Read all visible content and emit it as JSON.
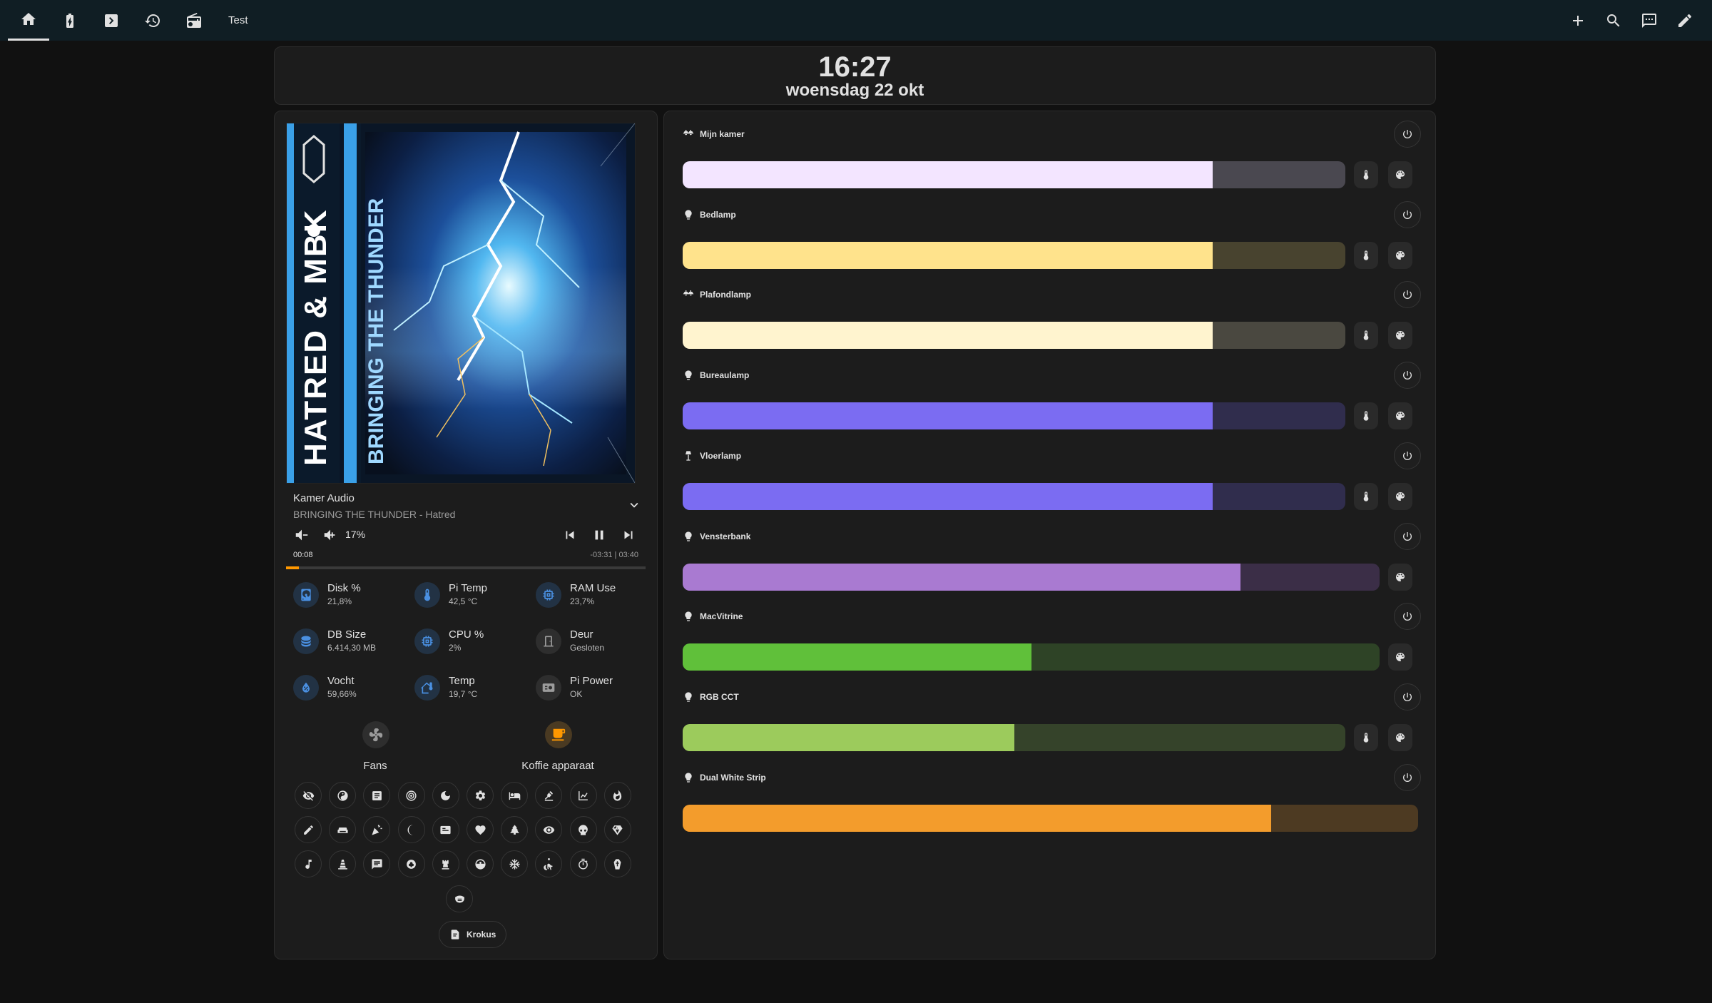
{
  "header": {
    "tabs": [
      {
        "icon": "home-icon"
      },
      {
        "icon": "battery-charging-icon"
      },
      {
        "icon": "chevron-right-box-icon"
      },
      {
        "icon": "history-icon"
      },
      {
        "icon": "radio-icon"
      }
    ],
    "text_tab": "Test",
    "tools": [
      {
        "icon": "plus-icon"
      },
      {
        "icon": "search-icon"
      },
      {
        "icon": "assist-chat-icon"
      },
      {
        "icon": "pencil-icon"
      }
    ]
  },
  "clock": {
    "time": "16:27",
    "date": "woensdag 22 okt"
  },
  "media": {
    "album_art": {
      "artist_text": "HATRED & MBK",
      "title_text": "BRINGING THE THUNDER"
    },
    "player_name": "Kamer Audio",
    "track": "BRINGING THE THUNDER - Hatred",
    "volume": "17%",
    "position": "00:08",
    "remaining": "-03:31 | 03:40",
    "progress_fraction": 0.036
  },
  "sensors": [
    {
      "name": "Disk %",
      "value": "21,8%",
      "icon": "harddisk-icon"
    },
    {
      "name": "Pi Temp",
      "value": "42,5 °C",
      "icon": "thermometer-icon"
    },
    {
      "name": "RAM Use",
      "value": "23,7%",
      "icon": "memory-icon"
    },
    {
      "name": "DB Size",
      "value": "6.414,30 MB",
      "icon": "database-icon"
    },
    {
      "name": "CPU %",
      "value": "2%",
      "icon": "cpu-icon"
    },
    {
      "name": "Deur",
      "value": "Gesloten",
      "icon": "door-closed-icon"
    },
    {
      "name": "Vocht",
      "value": "59,66%",
      "icon": "water-percent-icon"
    },
    {
      "name": "Temp",
      "value": "19,7 °C",
      "icon": "home-thermometer-icon"
    },
    {
      "name": "Pi Power",
      "value": "OK",
      "icon": "power-supply-icon"
    }
  ],
  "toggles": [
    {
      "label": "Fans",
      "icon": "fan-icon",
      "state": "off"
    },
    {
      "label": "Koffie apparaat",
      "icon": "coffee-icon",
      "state": "on"
    }
  ],
  "chips": [
    "eye-off-icon",
    "yin-yang-icon",
    "notes-icon",
    "target-icon",
    "moon-icon",
    "cog-icon",
    "bed-icon",
    "beach-icon",
    "chart-icon",
    "fire-icon",
    "pencil-icon",
    "couch-icon",
    "party-popper-icon",
    "moon-crescent-icon",
    "card-icon",
    "heart-icon",
    "pine-tree-icon",
    "eye-icon",
    "skull-icon",
    "diamond-icon",
    "music-icon",
    "cone-icon",
    "message-icon",
    "flower-icon",
    "chess-rook-icon",
    "robot-vacuum-icon",
    "snowflake-icon",
    "wheelchair-icon",
    "timer-icon",
    "coffin-icon",
    "face-mask-icon"
  ],
  "krokus_chip": {
    "label": "Krokus",
    "icon": "script-icon"
  },
  "lights": [
    {
      "name": "Mijn kamer",
      "icon": "ceiling-light-multiple-icon",
      "brightness": 0.8,
      "fill": "#f3e5ff",
      "track": "#4a4850",
      "controls": [
        "temperature",
        "color"
      ]
    },
    {
      "name": "Bedlamp",
      "icon": "lightbulb-icon",
      "brightness": 0.8,
      "fill": "#ffe38c",
      "track": "#48432f",
      "controls": [
        "temperature",
        "color"
      ]
    },
    {
      "name": "Plafondlamp",
      "icon": "ceiling-light-multiple-icon",
      "brightness": 0.8,
      "fill": "#fff4cf",
      "track": "#4a4840",
      "controls": [
        "temperature",
        "color"
      ]
    },
    {
      "name": "Bureaulamp",
      "icon": "lightbulb-icon",
      "brightness": 0.8,
      "fill": "#7b6cf2",
      "track": "#302d4d",
      "controls": [
        "temperature",
        "color"
      ]
    },
    {
      "name": "Vloerlamp",
      "icon": "floor-lamp-icon",
      "brightness": 0.8,
      "fill": "#7b6cf2",
      "track": "#302d4d",
      "controls": [
        "temperature",
        "color"
      ]
    },
    {
      "name": "Vensterbank",
      "icon": "lightbulb-icon",
      "brightness": 0.8,
      "fill": "#a97ad1",
      "track": "#3b2e47",
      "controls": [
        "color"
      ]
    },
    {
      "name": "MacVitrine",
      "icon": "lightbulb-icon",
      "brightness": 0.5,
      "fill": "#60c03a",
      "track": "#2e4326",
      "controls": [
        "color"
      ]
    },
    {
      "name": "RGB CCT",
      "icon": "lightbulb-icon",
      "brightness": 0.5,
      "fill": "#9ccb5c",
      "track": "#35432a",
      "controls": [
        "temperature",
        "color"
      ]
    },
    {
      "name": "Dual White Strip",
      "icon": "lightbulb-icon",
      "brightness": 0.8,
      "fill": "#f39c2c",
      "track": "#4d3a22",
      "controls": []
    }
  ]
}
